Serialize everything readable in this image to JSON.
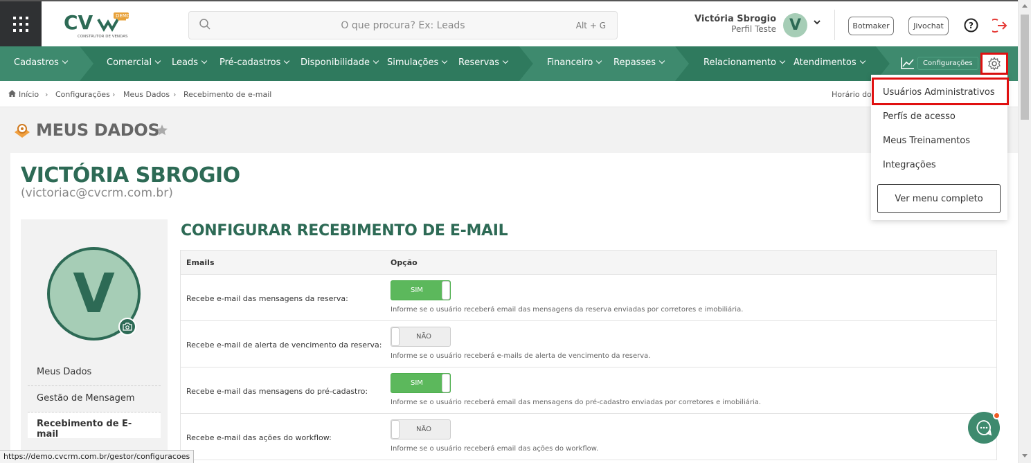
{
  "header": {
    "logo_text": "CV",
    "logo_sub": "CONSTRUTOR DE VENDAS",
    "logo_badge": "DEMO",
    "search_placeholder": "O que procura? Ex: Leads",
    "search_shortcut": "Alt + G",
    "user_name": "Victória Sbrogio",
    "user_role": "Perfil Teste",
    "user_initial": "V",
    "botmaker_label": "Botmaker",
    "jivochat_label": "Jivochat"
  },
  "nav": {
    "items": [
      "Cadastros",
      "Comercial",
      "Leads",
      "Pré-cadastros",
      "Disponibilidade",
      "Simulações",
      "Reservas",
      "Financeiro",
      "Repasses",
      "Relacionamento",
      "Atendimentos"
    ],
    "config_badge": "Configurações",
    "colors": {
      "primary": "#3e8a6e",
      "dark": "#2d6a55",
      "light": "#4a9a7c"
    }
  },
  "breadcrumb": {
    "items": [
      "Início",
      "Configurações",
      "Meus Dados",
      "Recebimento de e-mail"
    ],
    "hour_label": "Horário do"
  },
  "page": {
    "title": "MEUS DADOS",
    "user_full": "VICTÓRIA SBROGIO",
    "user_email": "(victoriac@cvcrm.com.br)",
    "avatar_initial": "V"
  },
  "sidebar": {
    "items": [
      {
        "label": "Meus Dados"
      },
      {
        "label": "Gestão de Mensagem"
      },
      {
        "label": "Recebimento de E-mail"
      }
    ]
  },
  "section": {
    "title": "CONFIGURAR RECEBIMENTO DE E-MAIL",
    "col_emails": "Emails",
    "col_option": "Opção",
    "rows": [
      {
        "label": "Recebe e-mail das mensagens da reserva:",
        "toggle": "SIM",
        "hint": "Informe se o usuário receberá email das mensagens da reserva enviadas por corretores e imobiliária."
      },
      {
        "label": "Recebe e-mail de alerta de vencimento da reserva:",
        "toggle": "NÃO",
        "hint": "Informe se o usuário receberá e-mails de alerta de vencimento da reserva."
      },
      {
        "label": "Recebe e-mail das mensagens do pré-cadastro:",
        "toggle": "SIM",
        "hint": "Informe se o usuário receberá email das mensagens do pré-cadastro enviadas por corretores e imobiliária."
      },
      {
        "label": "Recebe e-mail das ações do workflow:",
        "toggle": "NÃO",
        "hint": "Informe se o usuário receberá email das ações do workflow."
      }
    ]
  },
  "dropdown": {
    "items": [
      "Usuários Administrativos",
      "Perfís de acesso",
      "Meus Treinamentos",
      "Integrações"
    ],
    "full_menu_label": "Ver menu completo"
  },
  "status_url": "https://demo.cvcrm.com.br/gestor/configuracoes"
}
